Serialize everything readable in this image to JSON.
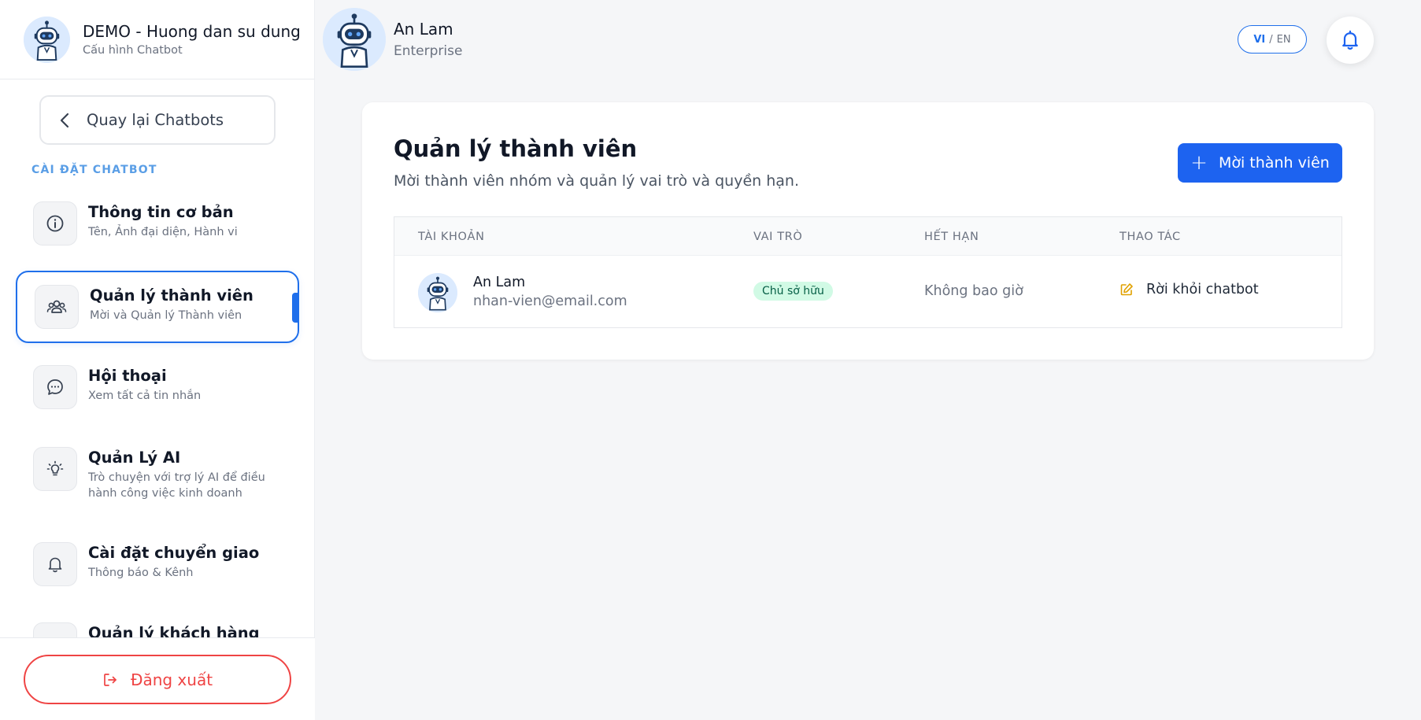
{
  "sidebar": {
    "header": {
      "title": "DEMO - Huong dan su dung",
      "subtitle": "Cấu hình Chatbot"
    },
    "back_label": "Quay lại Chatbots",
    "section_label": "CÀI ĐẶT CHATBOT",
    "items": [
      {
        "title": "Thông tin cơ bản",
        "desc": "Tên, Ảnh đại diện, Hành vi",
        "icon": "info-icon"
      },
      {
        "title": "Quản lý thành viên",
        "desc": "Mời và Quản lý Thành viên",
        "icon": "users-icon",
        "active": true
      },
      {
        "title": "Hội thoại",
        "desc": "Xem tất cả tin nhắn",
        "icon": "chat-icon"
      },
      {
        "title": "Quản Lý AI",
        "desc": "Trò chuyện với trợ lý AI để điều hành công việc kinh doanh",
        "icon": "lightbulb-icon"
      },
      {
        "title": "Cài đặt chuyển giao",
        "desc": "Thông báo & Kênh",
        "icon": "bell-icon"
      },
      {
        "title": "Quản lý khách hàng tiềm",
        "desc": "",
        "icon": "leads-icon"
      }
    ],
    "logout_label": "Đăng xuất"
  },
  "topbar": {
    "user_name": "An Lam",
    "plan": "Enterprise",
    "lang_vi": "VI",
    "lang_sep": "/",
    "lang_en": "EN"
  },
  "main": {
    "title": "Quản lý thành viên",
    "subtitle": "Mời thành viên nhóm và quản lý vai trò và quyền hạn.",
    "invite_label": "Mời thành viên",
    "table": {
      "headers": [
        "TÀI KHOẢN",
        "VAI TRÒ",
        "HẾT HẠN",
        "THAO TÁC"
      ],
      "rows": [
        {
          "name": "An Lam",
          "email": "nhan-vien@email.com",
          "role": "Chủ sở hữu",
          "expires": "Không bao giờ",
          "action": "Rời khỏi chatbot"
        }
      ]
    }
  },
  "colors": {
    "accent": "#1d63f0",
    "section_label": "#5a9ee6",
    "danger": "#ef4444",
    "badge_bg": "#d1fae5",
    "badge_text": "#065f46",
    "edit_icon": "#e0a100"
  }
}
